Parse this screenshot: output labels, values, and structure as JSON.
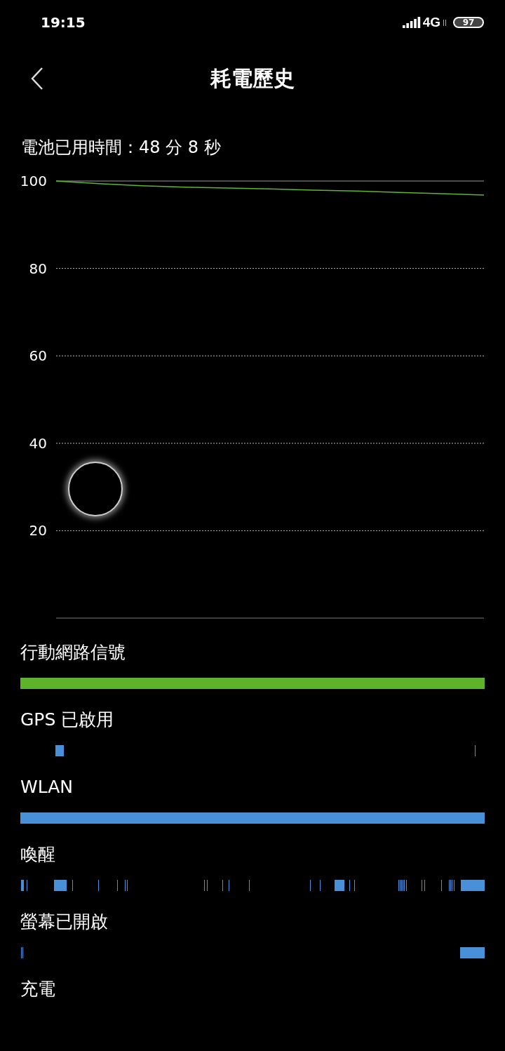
{
  "status_bar": {
    "time": "19:15",
    "network": "4G",
    "battery": "97"
  },
  "header": {
    "title": "耗電歷史"
  },
  "usage_time": "電池已用時間：48 分 8 秒",
  "chart": {
    "chart_data": {
      "type": "line",
      "categories": [
        null,
        null,
        null,
        null,
        null,
        null,
        null,
        null,
        null,
        null,
        null
      ],
      "ylim": [
        0,
        100
      ],
      "grid": true,
      "yticks": [
        20,
        40,
        60,
        80,
        100
      ],
      "series": [
        {
          "color": "#5fb336",
          "values": [
            100,
            99.4,
            98.9,
            98.6,
            98.4,
            98.2,
            97.9,
            97.7,
            97.4,
            97.1,
            96.8
          ]
        }
      ]
    }
  },
  "activity_rows": [
    {
      "label": "行動網路信號"
    },
    {
      "label": "GPS 已啟用"
    },
    {
      "label": "WLAN"
    },
    {
      "label": "喚醒"
    },
    {
      "label": "螢幕已開啟"
    },
    {
      "label": "充電"
    }
  ]
}
